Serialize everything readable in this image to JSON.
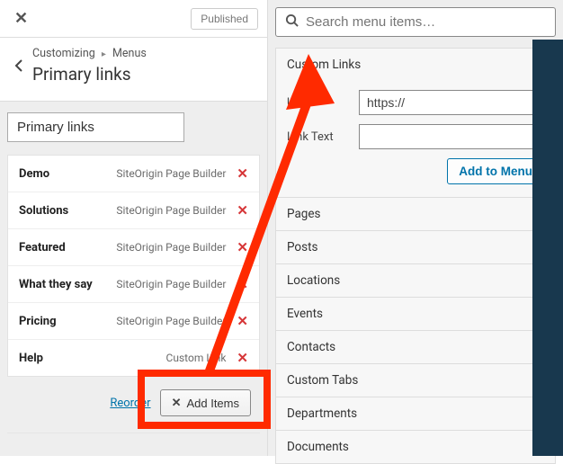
{
  "top": {
    "status_label": "Published"
  },
  "breadcrumb": {
    "root": "Customizing",
    "section": "Menus"
  },
  "page_title": "Primary links",
  "menu_name_value": "Primary links",
  "menu_items": [
    {
      "label": "Demo",
      "type": "SiteOrigin Page Builder"
    },
    {
      "label": "Solutions",
      "type": "SiteOrigin Page Builder"
    },
    {
      "label": "Featured",
      "type": "SiteOrigin Page Builder"
    },
    {
      "label": "What they say",
      "type": "SiteOrigin Page Builder"
    },
    {
      "label": "Pricing",
      "type": "SiteOrigin Page Builder"
    },
    {
      "label": "Help",
      "type": "Custom Link"
    }
  ],
  "footer": {
    "reorder_label": "Reorder",
    "add_items_label": "Add Items"
  },
  "search": {
    "placeholder": "Search menu items…"
  },
  "custom_links": {
    "title": "Custom Links",
    "url_label": "URL",
    "url_value": "https://",
    "link_text_label": "Link Text",
    "link_text_value": "",
    "add_label": "Add to Menu"
  },
  "accordion_sections": [
    "Pages",
    "Posts",
    "Locations",
    "Events",
    "Contacts",
    "Custom Tabs",
    "Departments",
    "Documents"
  ]
}
